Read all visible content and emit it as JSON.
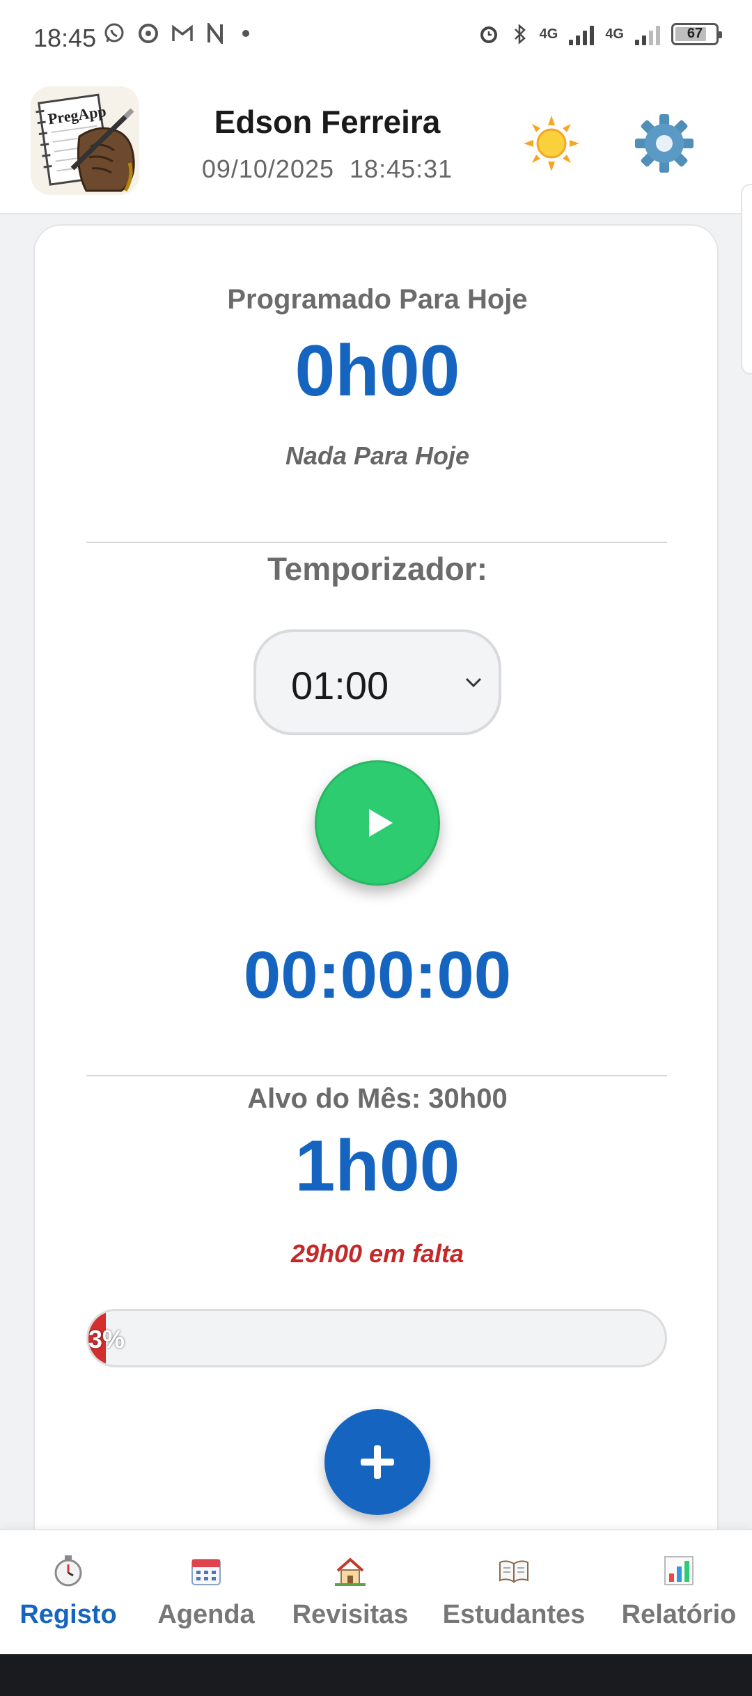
{
  "status_bar": {
    "time": "18:45",
    "left_icons": [
      "whatsapp-icon",
      "chrome-icon",
      "gmail-icon",
      "notion-icon",
      "dot-icon"
    ],
    "net1": "4G",
    "net2": "4G",
    "battery": "67"
  },
  "header": {
    "logo_text": "PregApp",
    "user_name": "Edson Ferreira",
    "date": "09/10/2025",
    "time": "18:45:31",
    "theme_icon": "sun-icon",
    "settings_icon": "gear-icon"
  },
  "today": {
    "label": "Programado Para Hoje",
    "value": "0h00",
    "note": "Nada Para Hoje"
  },
  "timer": {
    "label": "Temporizador:",
    "selected": "01:00",
    "display": "00:00:00"
  },
  "month": {
    "label": "Alvo do Mês: 30h00",
    "value": "1h00",
    "remaining": "29h00 em falta",
    "progress_text": "3%",
    "progress_fraction": 0.03
  },
  "nav": {
    "items": [
      {
        "label": "Registo",
        "icon": "stopwatch-icon"
      },
      {
        "label": "Agenda",
        "icon": "calendar-icon"
      },
      {
        "label": "Revisitas",
        "icon": "house-icon"
      },
      {
        "label": "Estudantes",
        "icon": "book-icon"
      },
      {
        "label": "Relatório",
        "icon": "chart-icon"
      }
    ]
  },
  "colors": {
    "accent": "#1565c0",
    "play": "#2ecc71",
    "warning": "#c62828",
    "progress": "#d32f2f"
  }
}
